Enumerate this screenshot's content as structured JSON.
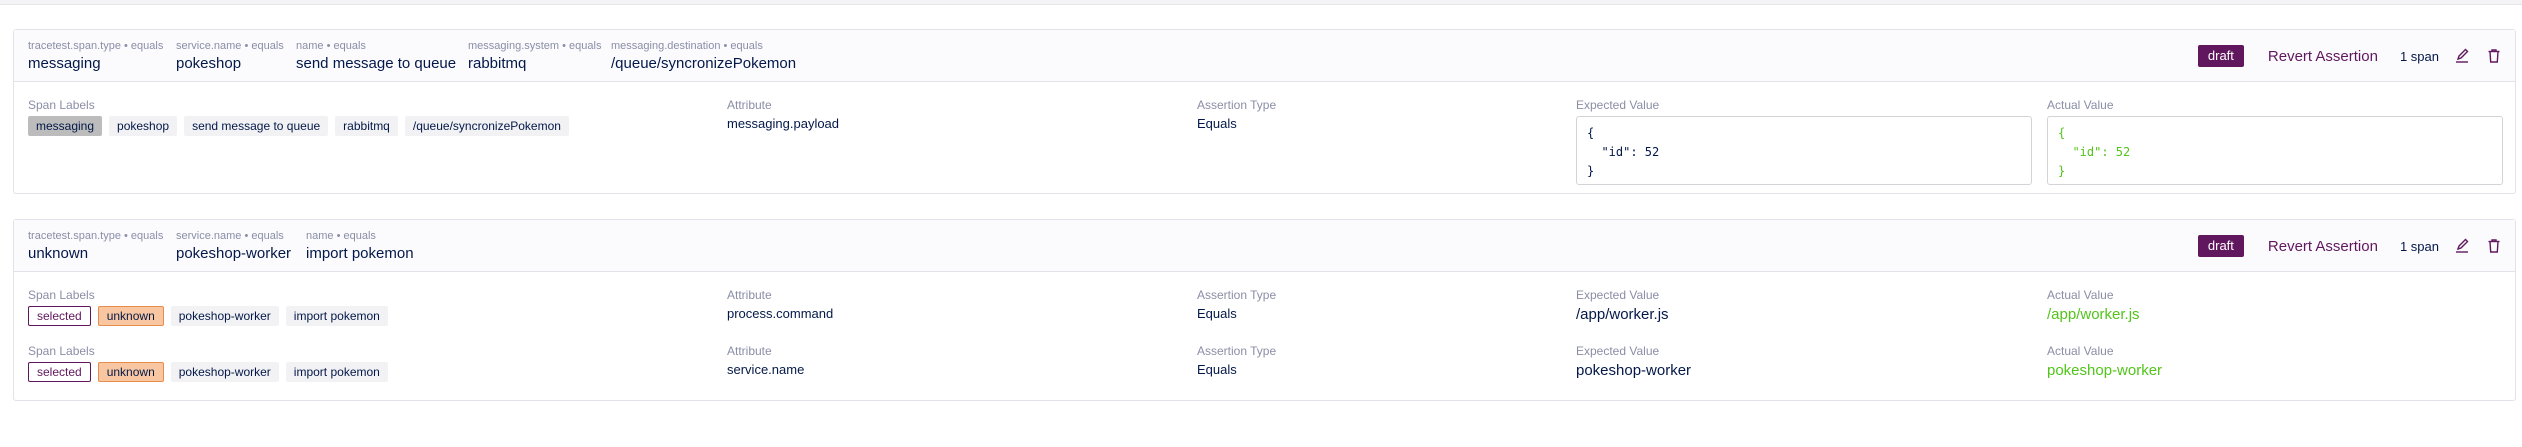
{
  "assertions": [
    {
      "selectors": [
        {
          "key": "tracetest.span.type • equals",
          "value": "messaging"
        },
        {
          "key": "service.name • equals",
          "value": "pokeshop"
        },
        {
          "key": "name • equals",
          "value": "send message to queue"
        },
        {
          "key": "messaging.system • equals",
          "value": "rabbitmq"
        },
        {
          "key": "messaging.destination • equals",
          "value": "/queue/syncronizePokemon"
        }
      ],
      "status_badge": "draft",
      "revert_label": "Revert Assertion",
      "span_count": "1 span",
      "rows": [
        {
          "span_labels_title": "Span Labels",
          "span_labels": [
            "messaging",
            "pokeshop",
            "send message to queue",
            "rabbitmq",
            "/queue/syncronizePokemon"
          ],
          "attribute_title": "Attribute",
          "attribute": "messaging.payload",
          "assertion_type_title": "Assertion Type",
          "assertion_type": "Equals",
          "expected_title": "Expected Value",
          "expected_lines": [
            "{",
            "  \"id\": 52",
            "}"
          ],
          "actual_title": "Actual Value",
          "actual_lines": [
            "{",
            "  \"id\": 52",
            "}"
          ]
        }
      ]
    },
    {
      "selectors": [
        {
          "key": "tracetest.span.type • equals",
          "value": "unknown"
        },
        {
          "key": "service.name • equals",
          "value": "pokeshop-worker"
        },
        {
          "key": "name • equals",
          "value": "import pokemon"
        }
      ],
      "status_badge": "draft",
      "revert_label": "Revert Assertion",
      "span_count": "1 span",
      "rows": [
        {
          "span_labels_title": "Span Labels",
          "span_labels": [
            "selected",
            "unknown",
            "pokeshop-worker",
            "import pokemon"
          ],
          "attribute_title": "Attribute",
          "attribute": "process.command",
          "assertion_type_title": "Assertion Type",
          "assertion_type": "Equals",
          "expected_title": "Expected Value",
          "expected": "/app/worker.js",
          "actual_title": "Actual Value",
          "actual": "/app/worker.js"
        },
        {
          "span_labels_title": "Span Labels",
          "span_labels": [
            "selected",
            "unknown",
            "pokeshop-worker",
            "import pokemon"
          ],
          "attribute_title": "Attribute",
          "attribute": "service.name",
          "assertion_type_title": "Assertion Type",
          "assertion_type": "Equals",
          "expected_title": "Expected Value",
          "expected": "pokeshop-worker",
          "actual_title": "Actual Value",
          "actual": "pokeshop-worker"
        }
      ]
    }
  ],
  "icons": {
    "edit": "pencil-icon",
    "delete": "trash-icon"
  },
  "colors": {
    "brand": "#61175e",
    "success": "#52c41a",
    "text": "#031849",
    "muted": "#8a8ea6"
  }
}
